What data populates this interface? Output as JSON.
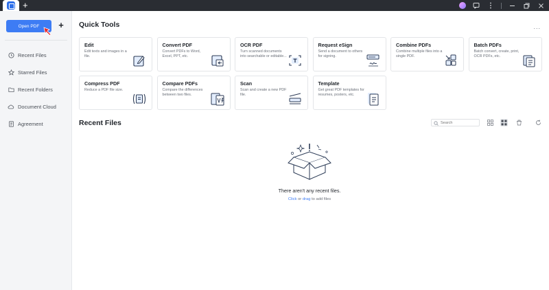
{
  "titlebar": {
    "new_tab": "+"
  },
  "sidebar": {
    "open_pdf": "Open PDF",
    "add": "+",
    "items": [
      {
        "label": "Recent Files",
        "icon": "clock-icon"
      },
      {
        "label": "Starred Files",
        "icon": "star-icon"
      },
      {
        "label": "Recent Folders",
        "icon": "folder-icon"
      },
      {
        "label": "Document Cloud",
        "icon": "cloud-icon"
      },
      {
        "label": "Agreement",
        "icon": "agreement-icon"
      }
    ]
  },
  "quick_tools": {
    "title": "Quick Tools",
    "more": "...",
    "tools": [
      {
        "title": "Edit",
        "desc": "Edit texts and images in a file.",
        "icon": "edit-icon"
      },
      {
        "title": "Convert PDF",
        "desc": "Convert PDFs to Word, Excel, PPT, etc.",
        "icon": "convert-icon"
      },
      {
        "title": "OCR PDF",
        "desc": "Turn scanned documents into searchable or editable...",
        "icon": "ocr-icon"
      },
      {
        "title": "Request eSign",
        "desc": "Send a document to others for signing.",
        "icon": "esign-icon"
      },
      {
        "title": "Combine PDFs",
        "desc": "Combine multiple files into a single PDF.",
        "icon": "combine-icon"
      },
      {
        "title": "Batch PDFs",
        "desc": "Batch convert, create, print, OCR PDFs, etc.",
        "icon": "batch-icon"
      },
      {
        "title": "Compress PDF",
        "desc": "Reduce a PDF file size.",
        "icon": "compress-icon"
      },
      {
        "title": "Compare PDFs",
        "desc": "Compare the differences between two files.",
        "icon": "compare-icon"
      },
      {
        "title": "Scan",
        "desc": "Scan and create a new PDF file.",
        "icon": "scan-icon"
      },
      {
        "title": "Template",
        "desc": "Get great PDF templates for resumes, posters, etc.",
        "icon": "template-icon"
      }
    ]
  },
  "recent_files": {
    "title": "Recent Files",
    "search_placeholder": "Search",
    "empty_title": "There aren't any recent files.",
    "empty_click": "Click",
    "empty_or": " or ",
    "empty_drag": "drag",
    "empty_rest": " to add files"
  },
  "colors": {
    "accent": "#3d7cf4",
    "sidebar_bg": "#f4f5f7",
    "titlebar_bg": "#2a2d33"
  }
}
